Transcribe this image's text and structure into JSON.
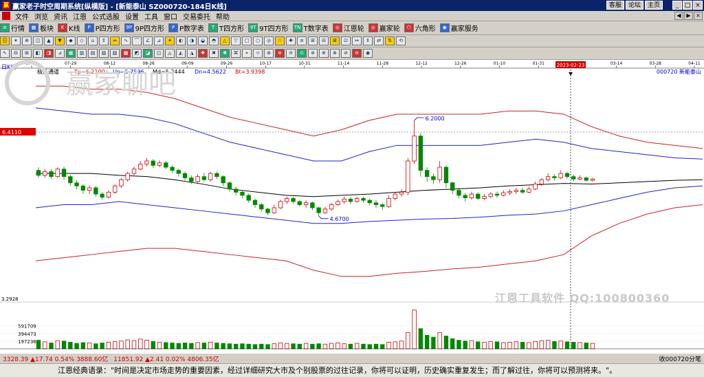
{
  "window": {
    "title": "赢家老子时空周期系统[纵横版] - [新能泰山   SZ000720-184日K线]",
    "links": [
      "客服",
      "论坛",
      "主页"
    ],
    "buttons": [
      "_",
      "□",
      "×"
    ]
  },
  "menu": {
    "items": [
      "文件",
      "浏览",
      "资讯",
      "江恩",
      "公式选股",
      "设置",
      "工具",
      "窗口",
      "交易委托",
      "帮助"
    ],
    "right_buttons": [
      "◀",
      "▶",
      "×"
    ]
  },
  "toolbar1": {
    "items": [
      {
        "icon": "grid-icon",
        "glyph": "≡",
        "label": "行情"
      },
      {
        "icon": "blocks-icon",
        "glyph": "▦",
        "label": "板块"
      },
      {
        "icon": "kline-icon",
        "glyph": "K",
        "label": "K线"
      },
      {
        "icon": "p-square-icon",
        "glyph": "P",
        "label": "P四方形"
      },
      {
        "icon": "9p-square-icon",
        "glyph": "9P",
        "label": "9P四方形"
      },
      {
        "icon": "p-number-icon",
        "glyph": "P",
        "label": "P数字表"
      },
      {
        "icon": "t-square-icon",
        "glyph": "T",
        "label": "T四方形"
      },
      {
        "icon": "9t-square-icon",
        "glyph": "9T",
        "label": "9T四方形"
      },
      {
        "icon": "t-number-icon",
        "glyph": "TN",
        "label": "T数字表"
      },
      {
        "icon": "gann-wheel-icon",
        "glyph": "◎",
        "label": "江恩轮"
      },
      {
        "icon": "winner-wheel-icon",
        "glyph": "◎",
        "label": "赢家轮"
      },
      {
        "icon": "hexagon-icon",
        "glyph": "⬡",
        "label": "六角形"
      },
      {
        "icon": "service-icon",
        "glyph": "◉",
        "label": "赢家服务"
      }
    ]
  },
  "chart": {
    "period_label": "日K线",
    "indicator_name": "极反通道",
    "indicators": [
      {
        "label": "Tp=6.2100",
        "color": "#cc0000"
      },
      {
        "label": "Up=5.7596",
        "color": "#0000cc"
      },
      {
        "label": "Md=5.2444",
        "color": "#000000"
      },
      {
        "label": "Dn=4.5622",
        "color": "#0000cc"
      },
      {
        "label": "Bt=3.9398",
        "color": "#cc0000"
      }
    ],
    "stock_code_name": "000720  新能泰山",
    "date_ticks": [
      "07-15",
      "07-29",
      "08-12",
      "08-26",
      "09-09",
      "09-26",
      "10-17",
      "10-31",
      "11-14",
      "11-28",
      "12-12",
      "12-26",
      "01-10",
      "01-31",
      "02-14",
      "03-14",
      "03-28",
      "04-11"
    ],
    "cursor_date": "2023-02-23",
    "price_marker": "6.4110",
    "high_label": "6.2000",
    "low_label": "4.6700",
    "volume_labels": [
      "3.2928",
      "591709",
      "394473",
      "197236"
    ],
    "colors": {
      "up": "#cc0000",
      "down": "#008800",
      "mid": "#000000",
      "channel_outer": "#cc2222",
      "channel_inner": "#2222cc"
    }
  },
  "chart_data": {
    "type": "candlestick",
    "title": "",
    "y_range": [
      3.29,
      6.95
    ],
    "volume_range": [
      0,
      1100000
    ],
    "candles": [
      {
        "o": 5.4,
        "c": 5.32,
        "h": 5.45,
        "l": 5.28
      },
      {
        "o": 5.32,
        "c": 5.38,
        "h": 5.42,
        "l": 5.28
      },
      {
        "o": 5.38,
        "c": 5.3,
        "h": 5.42,
        "l": 5.26
      },
      {
        "o": 5.3,
        "c": 5.42,
        "h": 5.45,
        "l": 5.28
      },
      {
        "o": 5.42,
        "c": 5.3,
        "h": 5.46,
        "l": 5.25
      },
      {
        "o": 5.3,
        "c": 5.2,
        "h": 5.33,
        "l": 5.15
      },
      {
        "o": 5.2,
        "c": 5.15,
        "h": 5.24,
        "l": 5.1
      },
      {
        "o": 5.15,
        "c": 5.08,
        "h": 5.18,
        "l": 5.02
      },
      {
        "o": 5.08,
        "c": 5.12,
        "h": 5.16,
        "l": 5.02
      },
      {
        "o": 5.12,
        "c": 5.02,
        "h": 5.15,
        "l": 4.98
      },
      {
        "o": 5.02,
        "c": 4.97,
        "h": 5.05,
        "l": 4.93
      },
      {
        "o": 4.97,
        "c": 5.05,
        "h": 5.08,
        "l": 4.95
      },
      {
        "o": 5.05,
        "c": 5.15,
        "h": 5.18,
        "l": 5.02
      },
      {
        "o": 5.15,
        "c": 5.25,
        "h": 5.28,
        "l": 5.12
      },
      {
        "o": 5.25,
        "c": 5.35,
        "h": 5.38,
        "l": 5.22
      },
      {
        "o": 5.35,
        "c": 5.42,
        "h": 5.46,
        "l": 5.32
      },
      {
        "o": 5.42,
        "c": 5.5,
        "h": 5.55,
        "l": 5.4
      },
      {
        "o": 5.5,
        "c": 5.55,
        "h": 5.6,
        "l": 5.46
      },
      {
        "o": 5.55,
        "c": 5.48,
        "h": 5.58,
        "l": 5.44
      },
      {
        "o": 5.48,
        "c": 5.52,
        "h": 5.56,
        "l": 5.45
      },
      {
        "o": 5.52,
        "c": 5.45,
        "h": 5.55,
        "l": 5.42
      },
      {
        "o": 5.45,
        "c": 5.4,
        "h": 5.48,
        "l": 5.36
      },
      {
        "o": 5.4,
        "c": 5.35,
        "h": 5.43,
        "l": 5.3
      },
      {
        "o": 5.35,
        "c": 5.28,
        "h": 5.38,
        "l": 5.24
      },
      {
        "o": 5.28,
        "c": 5.22,
        "h": 5.32,
        "l": 5.18
      },
      {
        "o": 5.22,
        "c": 5.3,
        "h": 5.34,
        "l": 5.2
      },
      {
        "o": 5.3,
        "c": 5.25,
        "h": 5.36,
        "l": 5.22
      },
      {
        "o": 5.25,
        "c": 5.35,
        "h": 5.38,
        "l": 5.22
      },
      {
        "o": 5.35,
        "c": 5.3,
        "h": 5.38,
        "l": 5.26
      },
      {
        "o": 5.3,
        "c": 5.2,
        "h": 5.32,
        "l": 5.15
      },
      {
        "o": 5.2,
        "c": 5.1,
        "h": 5.22,
        "l": 5.06
      },
      {
        "o": 5.1,
        "c": 5.05,
        "h": 5.14,
        "l": 5.0
      },
      {
        "o": 5.05,
        "c": 5.0,
        "h": 5.08,
        "l": 4.95
      },
      {
        "o": 5.0,
        "c": 4.92,
        "h": 5.03,
        "l": 4.88
      },
      {
        "o": 4.92,
        "c": 4.85,
        "h": 4.95,
        "l": 4.8
      },
      {
        "o": 4.85,
        "c": 4.78,
        "h": 4.88,
        "l": 4.74
      },
      {
        "o": 4.78,
        "c": 4.72,
        "h": 4.8,
        "l": 4.68
      },
      {
        "o": 4.72,
        "c": 4.8,
        "h": 4.85,
        "l": 4.7
      },
      {
        "o": 4.8,
        "c": 4.9,
        "h": 4.93,
        "l": 4.78
      },
      {
        "o": 4.9,
        "c": 4.95,
        "h": 4.98,
        "l": 4.86
      },
      {
        "o": 4.95,
        "c": 4.9,
        "h": 4.98,
        "l": 4.86
      },
      {
        "o": 4.9,
        "c": 4.85,
        "h": 4.93,
        "l": 4.82
      },
      {
        "o": 4.85,
        "c": 4.88,
        "h": 4.92,
        "l": 4.8
      },
      {
        "o": 4.88,
        "c": 4.8,
        "h": 4.9,
        "l": 4.76
      },
      {
        "o": 4.8,
        "c": 4.72,
        "h": 4.82,
        "l": 4.67
      },
      {
        "o": 4.72,
        "c": 4.78,
        "h": 4.82,
        "l": 4.7
      },
      {
        "o": 4.78,
        "c": 4.85,
        "h": 4.88,
        "l": 4.75
      },
      {
        "o": 4.85,
        "c": 4.9,
        "h": 4.93,
        "l": 4.83
      },
      {
        "o": 4.9,
        "c": 4.94,
        "h": 4.98,
        "l": 4.86
      },
      {
        "o": 4.94,
        "c": 4.9,
        "h": 4.97,
        "l": 4.86
      },
      {
        "o": 4.9,
        "c": 4.95,
        "h": 4.98,
        "l": 4.88
      },
      {
        "o": 4.95,
        "c": 4.92,
        "h": 4.98,
        "l": 4.88
      },
      {
        "o": 4.92,
        "c": 4.88,
        "h": 4.95,
        "l": 4.84
      },
      {
        "o": 4.88,
        "c": 4.85,
        "h": 4.92,
        "l": 4.8
      },
      {
        "o": 4.85,
        "c": 4.82,
        "h": 4.88,
        "l": 4.76
      },
      {
        "o": 4.82,
        "c": 4.95,
        "h": 5.0,
        "l": 4.8
      },
      {
        "o": 4.95,
        "c": 5.02,
        "h": 5.05,
        "l": 4.92
      },
      {
        "o": 5.02,
        "c": 5.05,
        "h": 5.1,
        "l": 4.98
      },
      {
        "o": 5.05,
        "c": 5.55,
        "h": 5.6,
        "l": 5.0
      },
      {
        "o": 5.55,
        "c": 5.95,
        "h": 6.2,
        "l": 5.5
      },
      {
        "o": 5.95,
        "c": 5.4,
        "h": 6.0,
        "l": 5.3
      },
      {
        "o": 5.4,
        "c": 5.3,
        "h": 5.45,
        "l": 5.22
      },
      {
        "o": 5.3,
        "c": 5.25,
        "h": 5.35,
        "l": 5.18
      },
      {
        "o": 5.25,
        "c": 5.45,
        "h": 5.55,
        "l": 5.2
      },
      {
        "o": 5.45,
        "c": 5.2,
        "h": 5.48,
        "l": 5.12
      },
      {
        "o": 5.2,
        "c": 5.08,
        "h": 5.22,
        "l": 5.02
      },
      {
        "o": 5.08,
        "c": 5.0,
        "h": 5.12,
        "l": 4.95
      },
      {
        "o": 5.0,
        "c": 4.96,
        "h": 5.04,
        "l": 4.9
      },
      {
        "o": 4.96,
        "c": 5.02,
        "h": 5.06,
        "l": 4.93
      },
      {
        "o": 5.02,
        "c": 4.95,
        "h": 5.05,
        "l": 4.92
      },
      {
        "o": 4.95,
        "c": 4.98,
        "h": 5.02,
        "l": 4.92
      },
      {
        "o": 4.98,
        "c": 5.02,
        "h": 5.05,
        "l": 4.95
      },
      {
        "o": 5.02,
        "c": 5.0,
        "h": 5.06,
        "l": 4.96
      },
      {
        "o": 5.0,
        "c": 5.04,
        "h": 5.08,
        "l": 4.98
      },
      {
        "o": 5.04,
        "c": 5.06,
        "h": 5.1,
        "l": 5.0
      },
      {
        "o": 5.06,
        "c": 5.08,
        "h": 5.12,
        "l": 5.02
      },
      {
        "o": 5.08,
        "c": 5.05,
        "h": 5.12,
        "l": 5.02
      },
      {
        "o": 5.05,
        "c": 5.1,
        "h": 5.14,
        "l": 5.03
      },
      {
        "o": 5.1,
        "c": 5.18,
        "h": 5.22,
        "l": 5.08
      },
      {
        "o": 5.18,
        "c": 5.25,
        "h": 5.28,
        "l": 5.15
      },
      {
        "o": 5.25,
        "c": 5.3,
        "h": 5.35,
        "l": 5.22
      },
      {
        "o": 5.3,
        "c": 5.28,
        "h": 5.34,
        "l": 5.24
      },
      {
        "o": 5.28,
        "c": 5.35,
        "h": 5.4,
        "l": 5.26
      },
      {
        "o": 5.35,
        "c": 5.3,
        "h": 5.38,
        "l": 5.26
      },
      {
        "o": 5.3,
        "c": 5.26,
        "h": 5.33,
        "l": 5.22
      },
      {
        "o": 5.26,
        "c": 5.28,
        "h": 5.32,
        "l": 5.24
      },
      {
        "o": 5.28,
        "c": 5.24,
        "h": 5.3,
        "l": 5.22
      },
      {
        "o": 5.24,
        "c": 5.26,
        "h": 5.28,
        "l": 5.22
      }
    ],
    "volumes": [
      220000,
      180000,
      150000,
      210000,
      200000,
      170000,
      140000,
      160000,
      150000,
      130000,
      150000,
      170000,
      190000,
      200000,
      230000,
      210000,
      250000,
      220000,
      190000,
      170000,
      160000,
      150000,
      140000,
      150000,
      140000,
      160000,
      150000,
      170000,
      150000,
      140000,
      130000,
      120000,
      130000,
      120000,
      110000,
      120000,
      110000,
      130000,
      150000,
      140000,
      130000,
      120000,
      140000,
      120000,
      130000,
      120000,
      140000,
      150000,
      130000,
      120000,
      140000,
      120000,
      110000,
      120000,
      110000,
      170000,
      180000,
      200000,
      420000,
      1000000,
      520000,
      350000,
      300000,
      420000,
      330000,
      260000,
      220000,
      200000,
      210000,
      180000,
      170000,
      190000,
      180000,
      160000,
      170000,
      180000,
      170000,
      160000,
      190000,
      210000,
      220000,
      190000,
      200000,
      180000,
      170000,
      160000,
      150000,
      140000
    ],
    "channel": {
      "tp": [
        6.75,
        6.75,
        6.7,
        6.7,
        6.65,
        6.55,
        6.4,
        6.25,
        6.15,
        6.05,
        5.95,
        6.05,
        6.2,
        6.3,
        6.3,
        6.3,
        6.3,
        6.35,
        6.35,
        6.3,
        6.1,
        5.95,
        5.85,
        5.8,
        5.75
      ],
      "up": [
        6.4,
        6.35,
        6.3,
        6.3,
        6.25,
        6.15,
        6.0,
        5.85,
        5.75,
        5.65,
        5.55,
        5.55,
        5.7,
        5.8,
        5.8,
        5.8,
        5.8,
        5.85,
        5.9,
        5.85,
        5.75,
        5.7,
        5.65,
        5.6,
        5.58
      ],
      "md": [
        5.35,
        5.35,
        5.35,
        5.32,
        5.3,
        5.25,
        5.18,
        5.1,
        5.05,
        5.0,
        4.98,
        5.0,
        5.02,
        5.05,
        5.08,
        5.1,
        5.12,
        5.15,
        5.17,
        5.19,
        5.18,
        5.2,
        5.22,
        5.24,
        5.25
      ],
      "dn": [
        4.8,
        4.85,
        4.85,
        4.9,
        4.85,
        4.8,
        4.75,
        4.7,
        4.65,
        4.6,
        4.55,
        4.55,
        4.58,
        4.6,
        4.62,
        4.63,
        4.65,
        4.68,
        4.7,
        4.75,
        4.85,
        4.95,
        5.05,
        5.12,
        5.15
      ],
      "bt": [
        3.95,
        4.0,
        4.05,
        4.1,
        4.15,
        4.15,
        4.1,
        4.05,
        4.0,
        3.95,
        3.8,
        3.7,
        3.7,
        3.75,
        3.78,
        3.82,
        3.85,
        3.9,
        3.95,
        4.05,
        4.35,
        4.55,
        4.7,
        4.8,
        4.85
      ]
    }
  },
  "statusbar": {
    "index1": "3328.39 ▲17.74 0.54% 3888.60亿",
    "index2": "11851.92 ▲2.41 0.02% 4806.35亿",
    "tail": "收000720分笔"
  },
  "watermark": {
    "line1": "江恩工具软件  QQ:100800360",
    "logo_text": "赢家聊吧"
  },
  "footer": {
    "quote": "江恩经典语录：\"时间是决定市场走势的重要因素，经过详细研究大市及个别股票的过往记录，你将可以证明，历史确实重复发生；而了解过往，你将可以预测将来。\"。"
  }
}
